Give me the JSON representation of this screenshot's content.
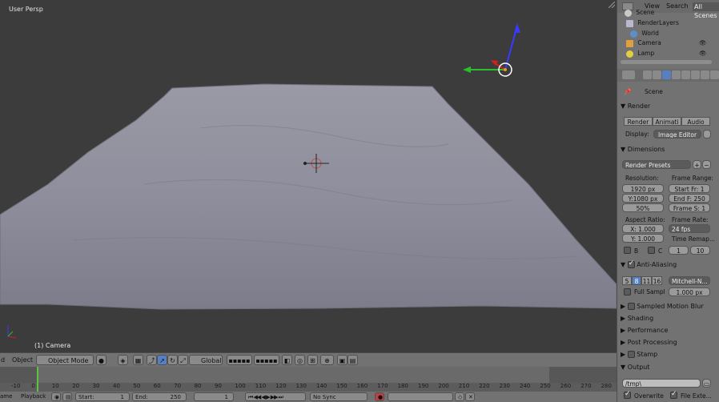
{
  "viewport": {
    "view_name": "User Persp",
    "object_label": "(1) Camera"
  },
  "header3d": {
    "menu_prev": "d",
    "menu_object": "Object",
    "mode": "Object Mode",
    "orientation": "Global"
  },
  "timeline": {
    "ticks": [
      "-10",
      "0",
      "10",
      "20",
      "30",
      "40",
      "50",
      "60",
      "70",
      "80",
      "90",
      "100",
      "110",
      "120",
      "130",
      "140",
      "150",
      "160",
      "170",
      "180",
      "190",
      "200",
      "210",
      "220",
      "230",
      "240",
      "250",
      "260",
      "270",
      "280"
    ]
  },
  "bottombar": {
    "frame_menu": "ame",
    "playback": "Playback",
    "start": "Start:",
    "start_val": "1",
    "end": "End:",
    "end_val": "250",
    "current": "1",
    "sync": "No Sync"
  },
  "outliner": {
    "view": "View",
    "search": "Search",
    "scope": "All Scenes",
    "items": [
      {
        "label": "Scene"
      },
      {
        "label": "RenderLayers"
      },
      {
        "label": "World"
      },
      {
        "label": "Camera"
      },
      {
        "label": "Lamp"
      }
    ]
  },
  "properties": {
    "context": "Scene",
    "render_section": "Render",
    "render_btn": "Render",
    "anim_btn": "Animati",
    "audio_btn": "Audio",
    "display_label": "Display:",
    "display_value": "Image Editor",
    "dimensions": "Dimensions",
    "presets": "Render Presets",
    "resolution": "Resolution:",
    "res_x": "1920 px",
    "res_y": "Y:1080 px",
    "res_pct": "50%",
    "frame_range": "Frame Range:",
    "start_fr": "Start Fr:  1",
    "end_fr": "End F: 250",
    "frame_step": "Frame S: 1",
    "aspect": "Aspect Ratio:",
    "asp_x": "X:   1.000",
    "asp_y": "Y:   1.000",
    "frame_rate": "Frame Rate:",
    "fps": "24 fps",
    "time_remap": "Time Remap...",
    "remap_a": "1",
    "remap_b": "10",
    "b_label": "B",
    "c_label": "C",
    "aa": "Anti-Aliasing",
    "aa_5": "5",
    "aa_8": "8",
    "aa_11": "11",
    "aa_16": "16",
    "filter": "Mitchell-N...",
    "full_sample": "Full Sampl",
    "filter_size": "1.000 px",
    "motion_blur": "Sampled Motion Blur",
    "shading": "Shading",
    "performance": "Performance",
    "post": "Post Processing",
    "stamp": "Stamp",
    "output": "Output",
    "output_path": "/tmp\\",
    "overwrite": "Overwrite",
    "file_ext": "File Exte..."
  }
}
